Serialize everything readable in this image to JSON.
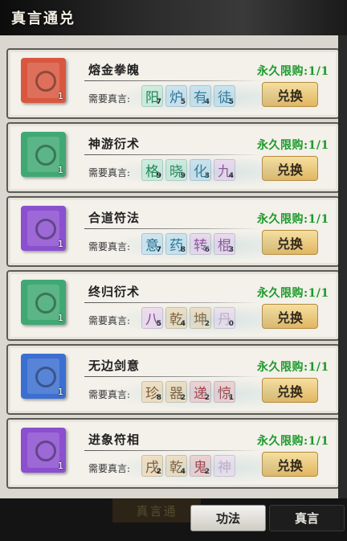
{
  "header": {
    "title": "真言通兑"
  },
  "common": {
    "need_label": "需要真言:",
    "exchange_label": "兑换"
  },
  "items": [
    {
      "name": "熔金拳魄",
      "limit": "永久限购:1/1",
      "count": "1",
      "book_color": "#d9573f",
      "glyphs": [
        {
          "char": "阳",
          "n": "7",
          "c": "green"
        },
        {
          "char": "炉",
          "n": "5",
          "c": "blue"
        },
        {
          "char": "有",
          "n": "4",
          "c": "blue"
        },
        {
          "char": "徒",
          "n": "5",
          "c": "blue"
        }
      ]
    },
    {
      "name": "神游衍术",
      "limit": "永久限购:1/1",
      "count": "1",
      "book_color": "#3fa873",
      "glyphs": [
        {
          "char": "格",
          "n": "9",
          "c": "green"
        },
        {
          "char": "晓",
          "n": "9",
          "c": "green"
        },
        {
          "char": "化",
          "n": "3",
          "c": "blue"
        },
        {
          "char": "九",
          "n": "4",
          "c": "pink"
        }
      ]
    },
    {
      "name": "合道符法",
      "limit": "永久限购:1/1",
      "count": "1",
      "book_color": "#8b4fcf",
      "glyphs": [
        {
          "char": "意",
          "n": "7",
          "c": "blue"
        },
        {
          "char": "药",
          "n": "8",
          "c": "blue"
        },
        {
          "char": "转",
          "n": "6",
          "c": "pink"
        },
        {
          "char": "棍",
          "n": "3",
          "c": "pink"
        }
      ]
    },
    {
      "name": "终归衍术",
      "limit": "永久限购:1/1",
      "count": "1",
      "book_color": "#3fa873",
      "glyphs": [
        {
          "char": "八",
          "n": "5",
          "c": "pink"
        },
        {
          "char": "乾",
          "n": "4",
          "c": "tan"
        },
        {
          "char": "坤",
          "n": "2",
          "c": "tan"
        },
        {
          "char": "丹",
          "n": "0",
          "c": "pale"
        }
      ]
    },
    {
      "name": "无边剑意",
      "limit": "永久限购:1/1",
      "count": "1",
      "book_color": "#3b6fd1",
      "glyphs": [
        {
          "char": "珍",
          "n": "8",
          "c": "tan"
        },
        {
          "char": "器",
          "n": "2",
          "c": "tan"
        },
        {
          "char": "递",
          "n": "2",
          "c": "red"
        },
        {
          "char": "惊",
          "n": "1",
          "c": "red"
        }
      ]
    },
    {
      "name": "进象符相",
      "limit": "永久限购:1/1",
      "count": "1",
      "book_color": "#8b4fcf",
      "glyphs": [
        {
          "char": "戌",
          "n": "2",
          "c": "tan"
        },
        {
          "char": "乾",
          "n": "4",
          "c": "tan"
        },
        {
          "char": "鬼",
          "n": "2",
          "c": "red"
        },
        {
          "char": "神",
          "n": "",
          "c": "pale"
        }
      ]
    }
  ],
  "ghost_title": "真言通",
  "tabs": [
    {
      "label": "功法"
    },
    {
      "label": "真言"
    }
  ]
}
